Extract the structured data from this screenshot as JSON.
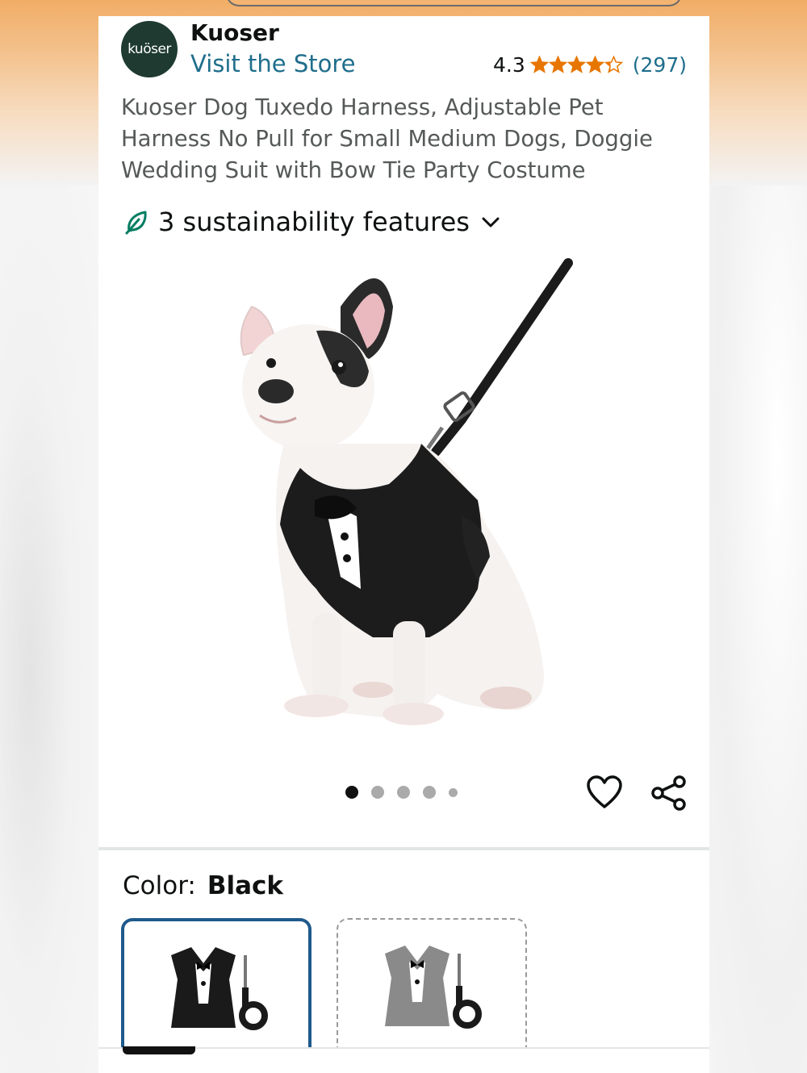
{
  "header": {
    "brand_logo_text": "kuöser",
    "brand_name": "Kuoser",
    "visit_store": "Visit the Store",
    "rating": "4.3",
    "stars_value": 4.3,
    "review_count": "(297)",
    "star_color": "#e77600"
  },
  "product": {
    "title": "Kuoser Dog Tuxedo Harness, Adjustable Pet Harness No Pull for Small Medium Dogs, Doggie Wedding Suit with Bow Tie Party Costume"
  },
  "sustainability": {
    "label": "3 sustainability features",
    "icon": "leaf-icon",
    "accent": "#067d62"
  },
  "gallery": {
    "image_count": 5,
    "active_index": 0,
    "actions": [
      "heart-icon",
      "share-icon"
    ]
  },
  "color": {
    "label": "Color:",
    "value": "Black",
    "options": [
      {
        "name": "black-tuxedo-swatch",
        "selected": true,
        "color": "#1a1a1a"
      },
      {
        "name": "gray-tuxedo-swatch",
        "selected": false,
        "color": "#8a8a8a"
      }
    ]
  }
}
